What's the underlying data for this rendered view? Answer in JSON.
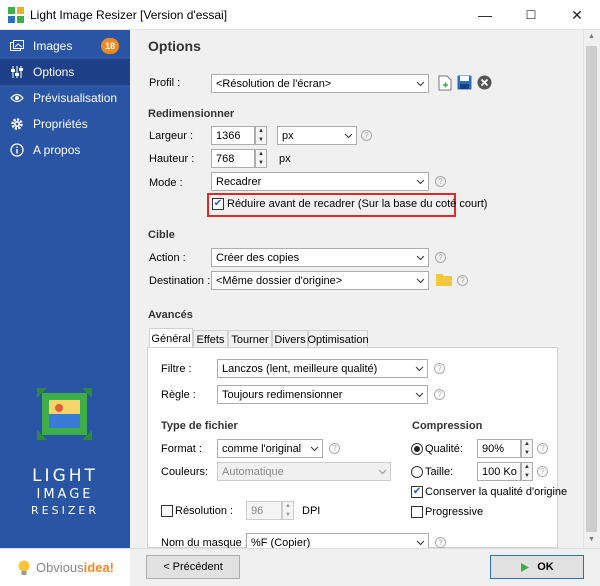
{
  "window": {
    "title": "Light Image Resizer  [Version d'essai]",
    "minimize_glyph": "—",
    "maximize_glyph": "☐",
    "close_glyph": "✕"
  },
  "sidebar": {
    "items": [
      {
        "label": "Images",
        "badge": "18",
        "icon": "images-icon"
      },
      {
        "label": "Options",
        "icon": "sliders-icon"
      },
      {
        "label": "Prévisualisation",
        "icon": "eye-icon"
      },
      {
        "label": "Propriétés",
        "icon": "gear-icon"
      },
      {
        "label": "A propos",
        "icon": "info-icon"
      }
    ],
    "logo": {
      "line1": "LIGHT",
      "line2": "IMAGE",
      "line3": "RESIZER"
    },
    "brand": {
      "part1": "Obvious",
      "part2": "idea!"
    }
  },
  "options": {
    "heading": "Options",
    "profile_label": "Profil :",
    "profile_value": "<Résolution de l'écran>",
    "resize": {
      "section": "Redimensionner",
      "width_label": "Largeur :",
      "width_value": "1366",
      "unit_value": "px",
      "height_label": "Hauteur :",
      "height_value": "768",
      "height_unit": "px",
      "mode_label": "Mode :",
      "mode_value": "Recadrer",
      "reduce_label": "Réduire avant de recadrer (Sur la base du coté court)",
      "reduce_checked": true
    },
    "target": {
      "section": "Cible",
      "action_label": "Action :",
      "action_value": "Créer des copies",
      "destination_label": "Destination :",
      "destination_value": "<Même dossier d'origine>"
    },
    "advanced": {
      "section": "Avancés",
      "tabs": [
        "Général",
        "Effets",
        "Tourner",
        "Divers",
        "Optimisation"
      ],
      "filter_label": "Filtre :",
      "filter_value": "Lanczos  (lent, meilleure qualité)",
      "rule_label": "Règle :",
      "rule_value": "Toujours redimensionner",
      "filetype_section": "Type de fichier",
      "format_label": "Format :",
      "format_value": "comme l'original",
      "colors_label": "Couleurs:",
      "colors_value": "Automatique",
      "resolution_label": "Résolution :",
      "resolution_value": "96",
      "resolution_unit": "DPI",
      "mask_label": "Nom du masque :",
      "mask_value": "%F (Copier)",
      "compression_section": "Compression",
      "quality_label": "Qualité:",
      "quality_value": "90%",
      "size_label": "Taille:",
      "size_value": "100 Ko",
      "keep_quality_label": "Conserver la qualité d'origine",
      "progressive_label": "Progressive"
    }
  },
  "footer": {
    "prev_label": "< Précédent",
    "ok_label": "OK"
  },
  "colors": {
    "sidebar": "#2a55a5",
    "highlight": "#e02828",
    "badge": "#f08a24",
    "accent": "#1d5fbf"
  }
}
